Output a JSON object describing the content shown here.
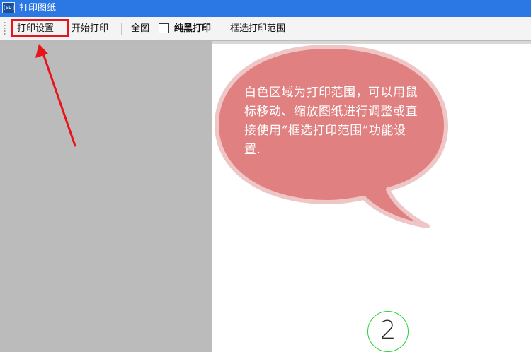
{
  "window": {
    "title": "打印图纸",
    "icon_name": "app-icon",
    "icon_text": "[SD]"
  },
  "toolbar": {
    "print_settings_label": "打印设置",
    "start_print_label": "开始打印",
    "full_view_label": "全图",
    "pure_black_print_label": "纯黑打印",
    "pure_black_checked": false,
    "box_select_range_label": "框选打印范围"
  },
  "annotation": {
    "callout_text": "白色区域为打印范围，可以用鼠标移动、缩放图纸进行调整或直接使用“框选打印范围”功能设置.",
    "callout_color": "#e08080",
    "highlight_color": "#e8141c",
    "arrow_color": "#e8141c"
  },
  "drawing": {
    "marker_number": "2",
    "marker_color": "#2fd23a"
  },
  "colors": {
    "titlebar": "#2b78e4",
    "left_pane": "#bbbbbb",
    "print_area": "#ffffff"
  }
}
